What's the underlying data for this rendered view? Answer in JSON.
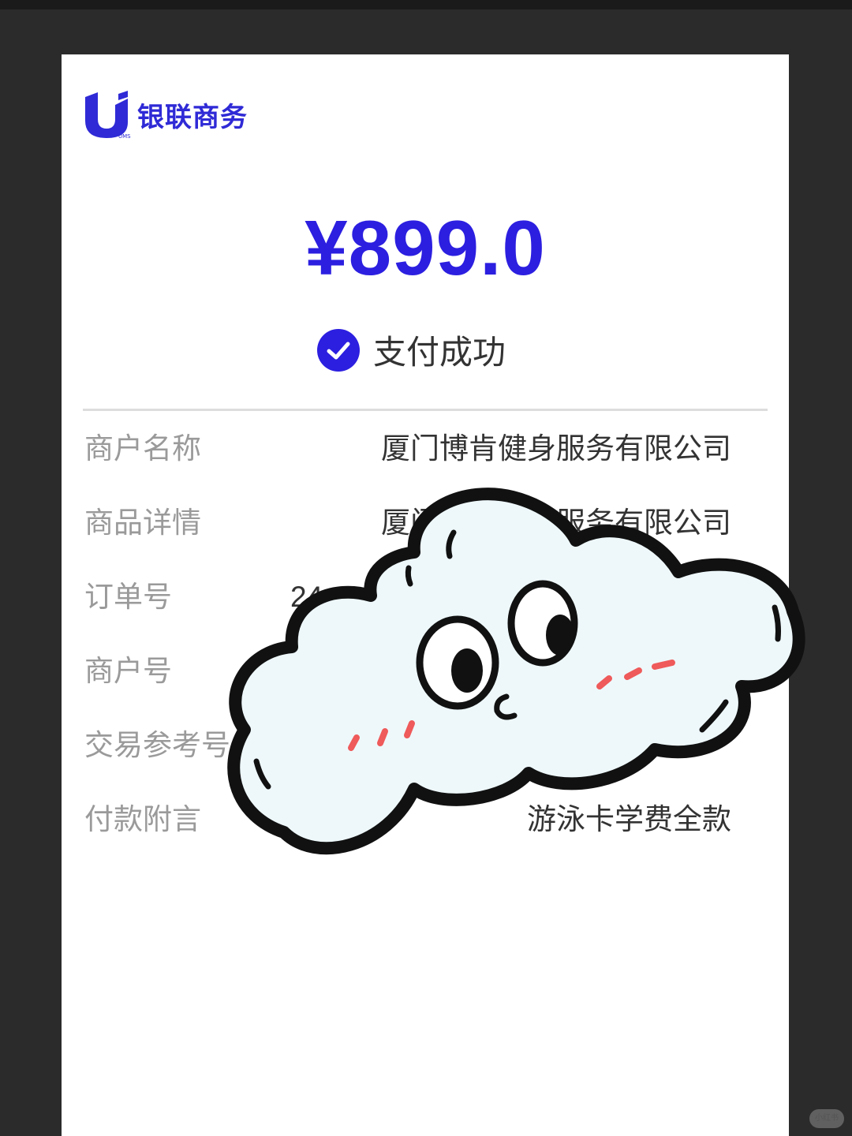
{
  "brand": {
    "name": "银联商务",
    "logo_caption": "UMS",
    "logo_icon": "unionpay-u-logo",
    "color": "#2f2ad6"
  },
  "payment": {
    "amount": "¥899.0",
    "status": "支付成功",
    "status_icon": "check-circle-icon",
    "accent_color": "#2c1fe0"
  },
  "details": [
    {
      "label": "商户名称",
      "value": "厦门博肯健身服务有限公司"
    },
    {
      "label": "商品详情",
      "value": "厦门博肯健身服务有限公司"
    },
    {
      "label": "订单号",
      "value": "24"
    },
    {
      "label": "商户号",
      "value": ""
    },
    {
      "label": "交易参考号",
      "value": ""
    },
    {
      "label": "付款附言",
      "value": "游泳卡学费全款"
    }
  ],
  "overlay": {
    "sticker": "cloud-character-sticker"
  },
  "watermark": {
    "text": "小红书"
  }
}
